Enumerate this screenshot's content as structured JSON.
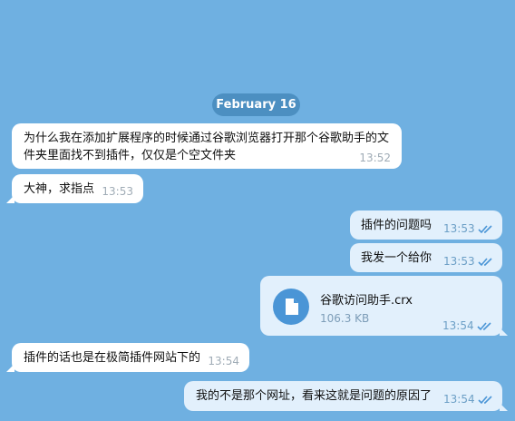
{
  "date_separator": "February 16",
  "messages": [
    {
      "text_line1": "为什么我在添加扩展程序的时候通过谷歌浏览器打开那个谷歌助手的文",
      "text_line2": "件夹里面找不到插件，仅仅是个空文件夹",
      "time": "13:52"
    },
    {
      "text": "大神，求指点",
      "time": "13:53"
    },
    {
      "text": "插件的问题吗",
      "time": "13:53"
    },
    {
      "text": "我发一个给你",
      "time": "13:53"
    },
    {
      "file_name": "谷歌访问助手.crx",
      "file_size": "106.3 KB",
      "time": "13:54"
    },
    {
      "text": "插件的话也是在极简插件网站下的",
      "time": "13:54"
    },
    {
      "text": "我的不是那个网址，看来这就是问题的原因了",
      "time": "13:54"
    }
  ],
  "colors": {
    "background": "#6fb0e1",
    "incoming": "#ffffff",
    "outgoing": "#e2f0fc",
    "accent": "#4a95d6"
  }
}
